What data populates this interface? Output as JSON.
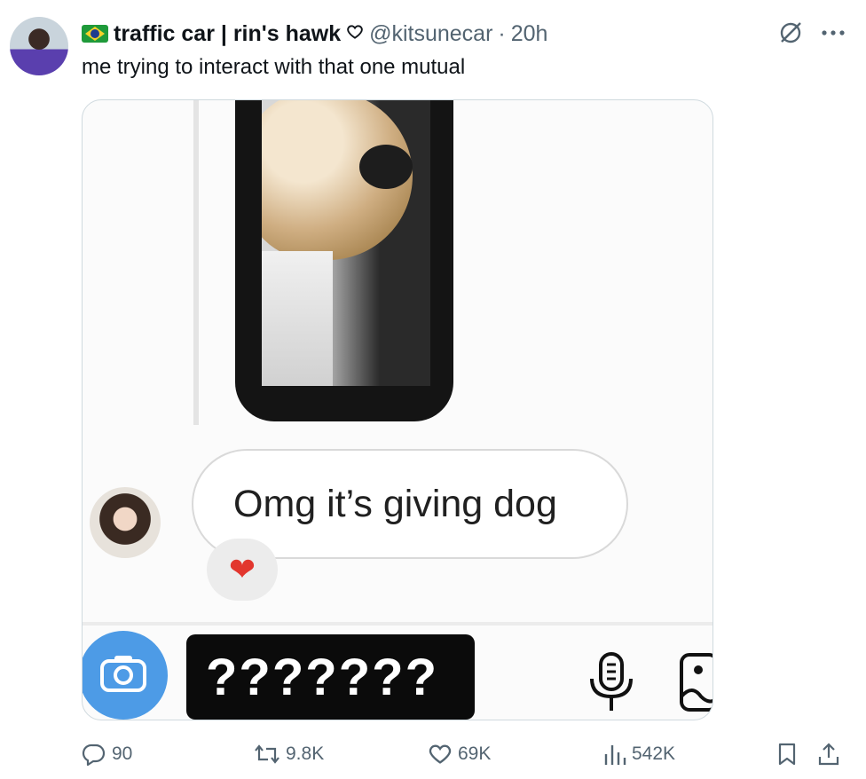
{
  "post": {
    "display_name": "traffic car | rin's hawk",
    "handle": "@kitsunecar",
    "separator": "·",
    "time": "20h",
    "text": "me trying to interact with that one mutual"
  },
  "media": {
    "message_text": "Omg it’s giving dog",
    "reaction": "❤",
    "composer_text": "???????"
  },
  "actions": {
    "replies": "90",
    "reposts": "9.8K",
    "likes": "69K",
    "views": "542K"
  },
  "colors": {
    "text": "#0f1419",
    "muted": "#536471",
    "camera": "#4d9be6",
    "heart": "#e2362e"
  },
  "icons": [
    "heart-outline-icon",
    "grok-icon",
    "more-icon",
    "reply-icon",
    "repost-icon",
    "like-icon",
    "views-icon",
    "bookmark-icon",
    "share-icon",
    "camera-icon",
    "mic-icon",
    "gallery-icon"
  ]
}
